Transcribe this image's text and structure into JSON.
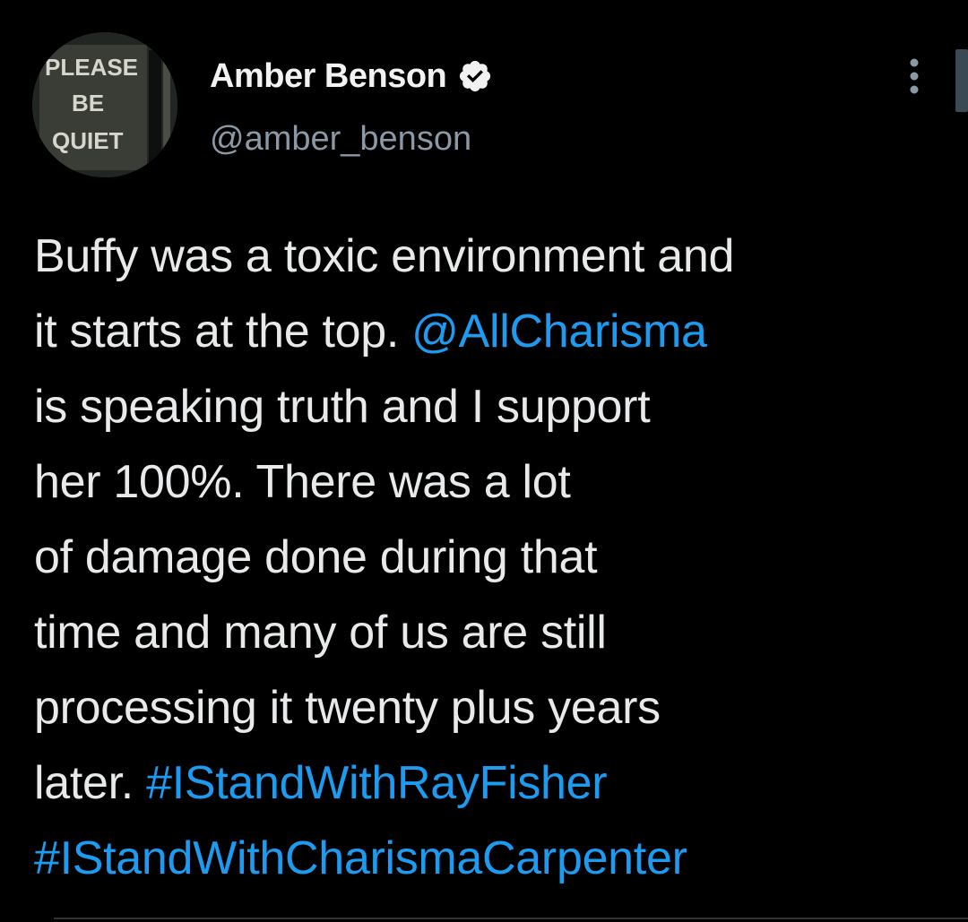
{
  "author": {
    "display_name": "Amber Benson",
    "handle": "@amber_benson",
    "verified": true,
    "avatar_text": [
      "PLEASE",
      "BE",
      "QUIET"
    ]
  },
  "tweet": {
    "lines": [
      [
        {
          "text": "Buffy was a toxic environment and",
          "type": "text"
        }
      ],
      [
        {
          "text": "it starts at the top. ",
          "type": "text"
        },
        {
          "text": "@AllCharisma",
          "type": "mention"
        }
      ],
      [
        {
          "text": "is speaking truth and I support",
          "type": "text"
        }
      ],
      [
        {
          "text": "her 100%. There was a lot",
          "type": "text"
        }
      ],
      [
        {
          "text": "of damage done during that",
          "type": "text"
        }
      ],
      [
        {
          "text": "time and many of us are still",
          "type": "text"
        }
      ],
      [
        {
          "text": "processing it twenty plus years",
          "type": "text"
        }
      ],
      [
        {
          "text": "later. ",
          "type": "text"
        },
        {
          "text": "#IStandWithRayFisher",
          "type": "hashtag"
        }
      ],
      [
        {
          "text": "#IStandWithCharismaCarpenter",
          "type": "hashtag"
        }
      ]
    ]
  },
  "icons": {
    "verified": "verified-badge-icon",
    "more": "more-vertical-icon"
  },
  "colors": {
    "background": "#000000",
    "text": "#e7e9ea",
    "handle": "#8b98a5",
    "link": "#1d9bf0"
  }
}
